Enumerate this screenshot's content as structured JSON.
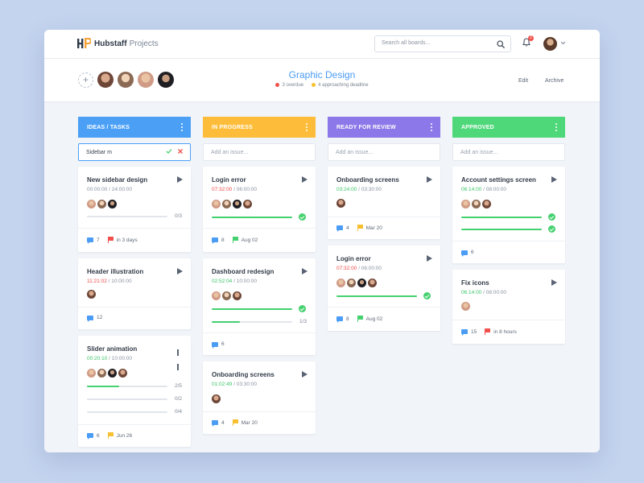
{
  "colors": {
    "ideas": "#4ba0f6",
    "in_progress": "#fdbd3a",
    "review": "#8c78e8",
    "approved": "#4fd87a",
    "accent": "#4b9cf5"
  },
  "app": {
    "name": "Hubstaff",
    "product": "Projects"
  },
  "search": {
    "placeholder": "Search all boards..."
  },
  "notifications": {
    "count": "2"
  },
  "board": {
    "title": "Graphic Design",
    "overdue": "3 overdue",
    "approaching": "4 approaching deadline",
    "edit_label": "Edit",
    "archive_label": "Archive"
  },
  "columns": [
    {
      "title": "IDEAS / TASKS",
      "input_value": "Sidebar m"
    },
    {
      "title": "IN PROGRESS",
      "input_placeholder": "Add an issue..."
    },
    {
      "title": "READY FOR REVIEW",
      "input_placeholder": "Add an issue..."
    },
    {
      "title": "APPROVED",
      "input_placeholder": "Add an issue..."
    }
  ],
  "cards": {
    "c1a": {
      "title": "New sidebar design",
      "elapsed": "00:00:00",
      "estimate": "/ 24:00:00",
      "progress": [
        "0/3"
      ],
      "comments": "7",
      "due": "in 3 days"
    },
    "c1b": {
      "title": "Header illustration",
      "elapsed": "11:21:02",
      "estimate": "/ 10:00:00",
      "comments": "12"
    },
    "c1c": {
      "title": "Slider animation",
      "elapsed": "00:20:10",
      "estimate": "/ 10:00:00",
      "progress": [
        "2/5",
        "0/2",
        "0/4"
      ],
      "comments": "6",
      "due": "Jun 26"
    },
    "c2a": {
      "title": "Login error",
      "elapsed": "07:32:00",
      "estimate": "/ 06:00:00",
      "comments": "8",
      "due": "Aug 02"
    },
    "c2b": {
      "title": "Dashboard redesign",
      "elapsed": "02:52:04",
      "estimate": "/ 10:00:00",
      "progress": [
        "1/3"
      ],
      "comments": "6"
    },
    "c2c": {
      "title": "Onboarding screens",
      "elapsed": "01:02:49",
      "estimate": "/ 03:30:00",
      "comments": "4",
      "due": "Mar 20"
    },
    "c3a": {
      "title": "Onboarding screens",
      "elapsed": "03:24:00",
      "estimate": "/ 03:30:00",
      "comments": "4",
      "due": "Mar 20"
    },
    "c3b": {
      "title": "Login error",
      "elapsed": "07:32:00",
      "estimate": "/ 06:00:00",
      "comments": "8",
      "due": "Aug 02"
    },
    "c4a": {
      "title": "Account settings screen",
      "elapsed": "06:14:00",
      "estimate": "/ 08:00:00",
      "comments": "6"
    },
    "c4b": {
      "title": "Fix icons",
      "elapsed": "06:14:00",
      "estimate": "/ 08:00:00",
      "comments": "15",
      "due": "in 8 hours"
    }
  }
}
